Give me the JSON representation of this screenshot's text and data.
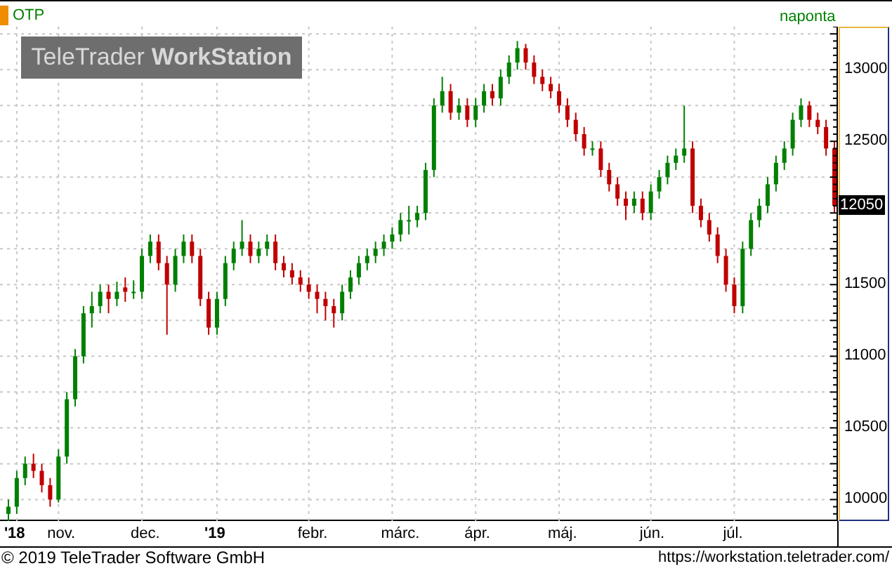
{
  "instrument": "OTP",
  "interval": "naponta",
  "logo": {
    "light": "TeleTrader",
    "bold": "WorkStation"
  },
  "chart_data": {
    "type": "candlestick",
    "grid": true,
    "ylim": [
      9850,
      13300
    ],
    "categories": [
      null,
      "'18",
      null,
      null,
      null,
      null,
      "nov.",
      null,
      null,
      null,
      null,
      null,
      null,
      null,
      null,
      null,
      "dec.",
      null,
      null,
      null,
      null,
      null,
      null,
      null,
      null,
      "'19",
      null,
      null,
      null,
      null,
      null,
      null,
      null,
      null,
      null,
      null,
      "febr.",
      null,
      null,
      null,
      null,
      null,
      null,
      null,
      null,
      null,
      "márc.",
      null,
      null,
      null,
      null,
      null,
      null,
      null,
      null,
      null,
      "ápr.",
      null,
      null,
      null,
      null,
      null,
      null,
      null,
      null,
      null,
      "máj.",
      null,
      null,
      null,
      null,
      null,
      null,
      null,
      null,
      null,
      null,
      "jún.",
      null,
      null,
      null,
      null,
      null,
      null,
      null,
      null,
      null,
      "júl.",
      null,
      null,
      null,
      null,
      null,
      null,
      null,
      null,
      null,
      null,
      null,
      null
    ],
    "yticks": [
      {
        "value": 13000,
        "label": "13000"
      },
      {
        "value": 12500,
        "label": "12500"
      },
      {
        "value": 11500,
        "label": "11500"
      },
      {
        "value": 11000,
        "label": "11000"
      },
      {
        "value": 10500,
        "label": "10500"
      },
      {
        "value": 10000,
        "label": "10000"
      }
    ],
    "ohlc": [
      [
        9900,
        10000,
        9850,
        9950
      ],
      [
        9950,
        10200,
        9900,
        10150
      ],
      [
        10150,
        10300,
        10100,
        10250
      ],
      [
        10250,
        10320,
        10150,
        10200
      ],
      [
        10200,
        10250,
        10050,
        10100
      ],
      [
        10100,
        10150,
        9950,
        10000
      ],
      [
        10000,
        10350,
        9980,
        10300
      ],
      [
        10300,
        10750,
        10250,
        10700
      ],
      [
        10700,
        11050,
        10650,
        11000
      ],
      [
        11000,
        11350,
        10950,
        11300
      ],
      [
        11300,
        11450,
        11200,
        11350
      ],
      [
        11350,
        11500,
        11300,
        11450
      ],
      [
        11450,
        11500,
        11300,
        11400
      ],
      [
        11400,
        11520,
        11350,
        11450
      ],
      [
        11480,
        11550,
        11380,
        11450
      ],
      [
        11450,
        11530,
        11400,
        11450
      ],
      [
        11450,
        11750,
        11400,
        11700
      ],
      [
        11700,
        11850,
        11650,
        11800
      ],
      [
        11800,
        11850,
        11600,
        11650
      ],
      [
        11650,
        11700,
        11150,
        11500
      ],
      [
        11500,
        11750,
        11450,
        11700
      ],
      [
        11700,
        11850,
        11650,
        11800
      ],
      [
        11800,
        11850,
        11650,
        11700
      ],
      [
        11700,
        11750,
        11350,
        11400
      ],
      [
        11400,
        11450,
        11150,
        11200
      ],
      [
        11200,
        11450,
        11150,
        11400
      ],
      [
        11400,
        11700,
        11350,
        11650
      ],
      [
        11650,
        11800,
        11600,
        11750
      ],
      [
        11750,
        11950,
        11700,
        11800
      ],
      [
        11800,
        11850,
        11650,
        11700
      ],
      [
        11700,
        11800,
        11650,
        11750
      ],
      [
        11750,
        11850,
        11700,
        11800
      ],
      [
        11800,
        11850,
        11600,
        11650
      ],
      [
        11650,
        11700,
        11550,
        11600
      ],
      [
        11600,
        11650,
        11500,
        11550
      ],
      [
        11550,
        11600,
        11450,
        11500
      ],
      [
        11500,
        11550,
        11400,
        11450
      ],
      [
        11450,
        11500,
        11300,
        11400
      ],
      [
        11400,
        11450,
        11250,
        11350
      ],
      [
        11350,
        11400,
        11200,
        11300
      ],
      [
        11300,
        11500,
        11250,
        11450
      ],
      [
        11450,
        11600,
        11400,
        11550
      ],
      [
        11550,
        11700,
        11500,
        11650
      ],
      [
        11650,
        11750,
        11600,
        11700
      ],
      [
        11700,
        11800,
        11650,
        11750
      ],
      [
        11750,
        11850,
        11700,
        11800
      ],
      [
        11800,
        11900,
        11750,
        11850
      ],
      [
        11850,
        12000,
        11800,
        11950
      ],
      [
        11950,
        12050,
        11850,
        11950
      ],
      [
        11950,
        12050,
        11900,
        12000
      ],
      [
        12000,
        12350,
        11950,
        12300
      ],
      [
        12300,
        12800,
        12250,
        12750
      ],
      [
        12750,
        12950,
        12700,
        12850
      ],
      [
        12850,
        12900,
        12650,
        12700
      ],
      [
        12700,
        12800,
        12650,
        12750
      ],
      [
        12750,
        12800,
        12600,
        12650
      ],
      [
        12650,
        12800,
        12600,
        12750
      ],
      [
        12750,
        12900,
        12700,
        12850
      ],
      [
        12850,
        12900,
        12750,
        12800
      ],
      [
        12800,
        13000,
        12750,
        12950
      ],
      [
        12950,
        13100,
        12900,
        13050
      ],
      [
        13050,
        13200,
        13000,
        13150
      ],
      [
        13150,
        13180,
        13000,
        13050
      ],
      [
        13050,
        13100,
        12900,
        12950
      ],
      [
        12950,
        13000,
        12850,
        12900
      ],
      [
        12900,
        12950,
        12800,
        12850
      ],
      [
        12850,
        12900,
        12700,
        12750
      ],
      [
        12750,
        12800,
        12600,
        12650
      ],
      [
        12650,
        12700,
        12500,
        12550
      ],
      [
        12550,
        12600,
        12400,
        12450
      ],
      [
        12450,
        12500,
        12400,
        12450
      ],
      [
        12450,
        12500,
        12250,
        12300
      ],
      [
        12300,
        12350,
        12150,
        12200
      ],
      [
        12200,
        12250,
        12050,
        12100
      ],
      [
        12100,
        12150,
        11950,
        12050
      ],
      [
        12050,
        12150,
        12000,
        12100
      ],
      [
        12100,
        12150,
        11950,
        12000
      ],
      [
        12000,
        12200,
        11950,
        12150
      ],
      [
        12150,
        12300,
        12100,
        12250
      ],
      [
        12250,
        12400,
        12200,
        12350
      ],
      [
        12350,
        12450,
        12300,
        12400
      ],
      [
        12400,
        12750,
        12350,
        12450
      ],
      [
        12450,
        12500,
        12000,
        12050
      ],
      [
        12050,
        12100,
        11900,
        11950
      ],
      [
        11950,
        12000,
        11800,
        11850
      ],
      [
        11850,
        11900,
        11650,
        11700
      ],
      [
        11700,
        11750,
        11450,
        11500
      ],
      [
        11500,
        11550,
        11300,
        11350
      ],
      [
        11350,
        11800,
        11300,
        11750
      ],
      [
        11750,
        12000,
        11700,
        11950
      ],
      [
        11950,
        12100,
        11900,
        12050
      ],
      [
        12050,
        12250,
        12000,
        12200
      ],
      [
        12200,
        12400,
        12150,
        12350
      ],
      [
        12350,
        12500,
        12300,
        12450
      ],
      [
        12450,
        12700,
        12400,
        12650
      ],
      [
        12650,
        12800,
        12600,
        12750
      ],
      [
        12750,
        12780,
        12600,
        12650
      ],
      [
        12650,
        12700,
        12550,
        12600
      ],
      [
        12600,
        12650,
        12400,
        12450
      ],
      [
        12450,
        12500,
        12000,
        12050
      ]
    ]
  },
  "last_price": "12050",
  "x_axis_label_styles": [
    {
      "bold": true
    },
    {
      "bold": false
    },
    {
      "bold": false
    },
    {
      "bold": true
    },
    {
      "bold": false
    },
    {
      "bold": false
    },
    {
      "bold": false
    },
    {
      "bold": false
    },
    {
      "bold": false
    },
    {
      "bold": false
    }
  ],
  "footer": {
    "copyright": "© 2019 TeleTrader Software GmbH",
    "url": "https://workstation.teletrader.com/"
  }
}
